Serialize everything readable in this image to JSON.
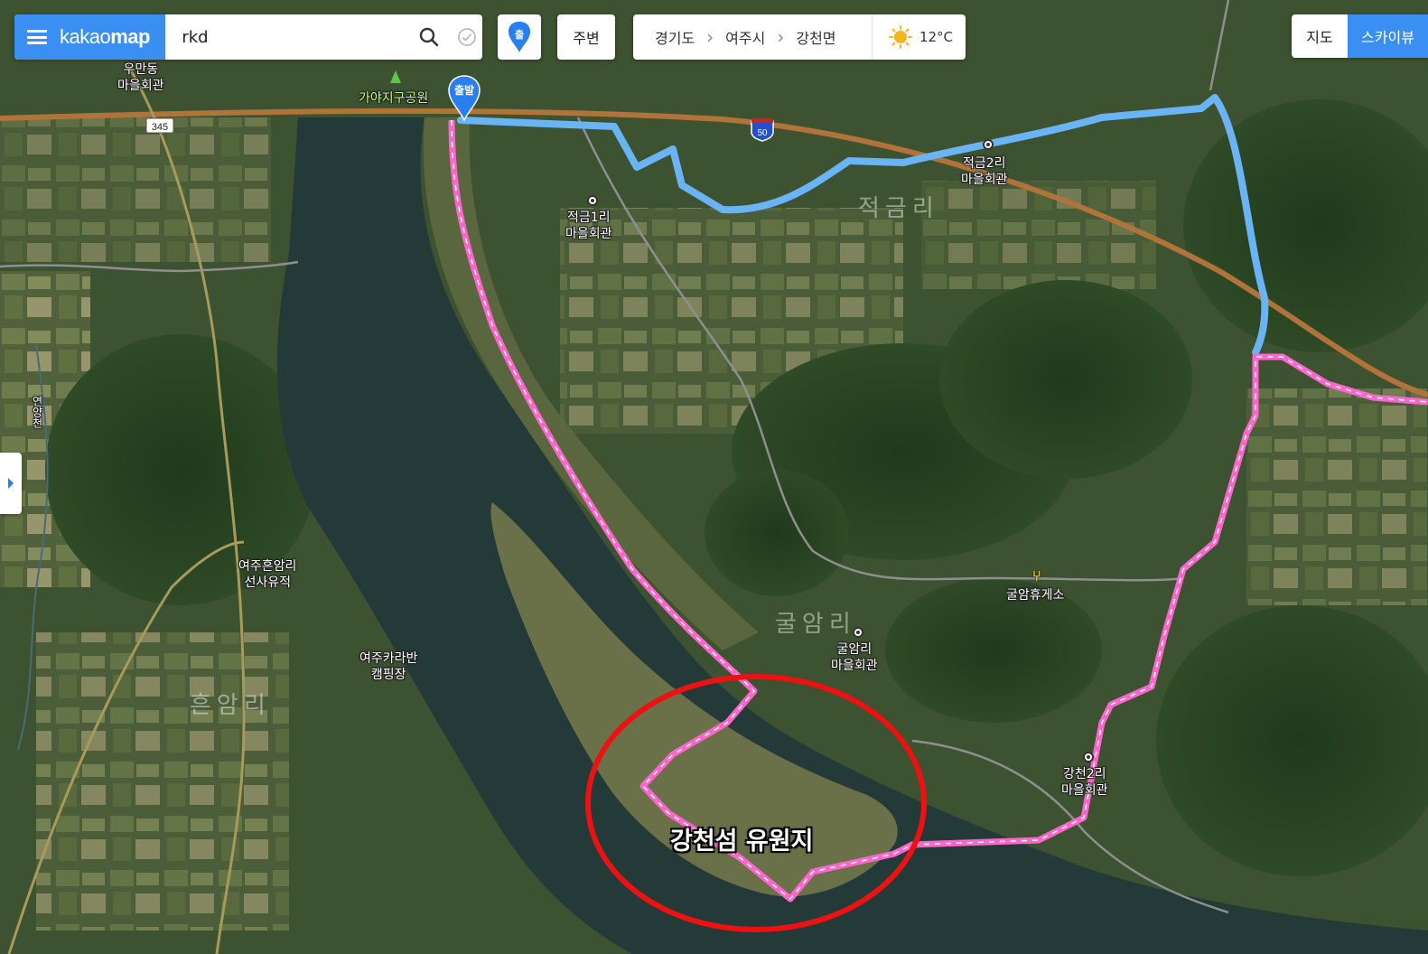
{
  "app": {
    "logo_prefix": "kakao",
    "logo_suffix": "map"
  },
  "search": {
    "value": "rkd"
  },
  "toolbar": {
    "route_label": "출",
    "nearby_label": "주변"
  },
  "breadcrumb": {
    "province": "경기도",
    "city": "여주시",
    "district": "강천면"
  },
  "weather": {
    "temperature": "12°C",
    "icon": "sun-icon"
  },
  "map_type": {
    "map_label": "지도",
    "skyview_label": "스카이뷰",
    "selected": "스카이뷰"
  },
  "route": {
    "start_label": "출발",
    "walk_color": "#ff66cc",
    "drive_color": "#6ab4f5"
  },
  "road_signs": {
    "route_345": "345",
    "route_50": "50"
  },
  "labels": {
    "uman_hall": "우만동\n마을회관",
    "gaya_park": "가야지구공원",
    "jeokgeum1": "적금1리\n마을회관",
    "jeokgeum2": "적금2리\n마을회관",
    "jeokgeum_area": "적금리",
    "heunam_site": "여주흔암리\n선사유적",
    "karaban": "여주카라반\n캠핑장",
    "heunam_area": "흔암리",
    "gulam_rest": "굴암휴게소",
    "gulam_area": "굴암리",
    "gulam_hall": "굴암리\n마을회관",
    "gangcheon2": "강천2리\n마을회관",
    "stream": "연양천"
  },
  "annotation": {
    "text": "강천섬 유원지",
    "circle_color": "#ee1111"
  }
}
